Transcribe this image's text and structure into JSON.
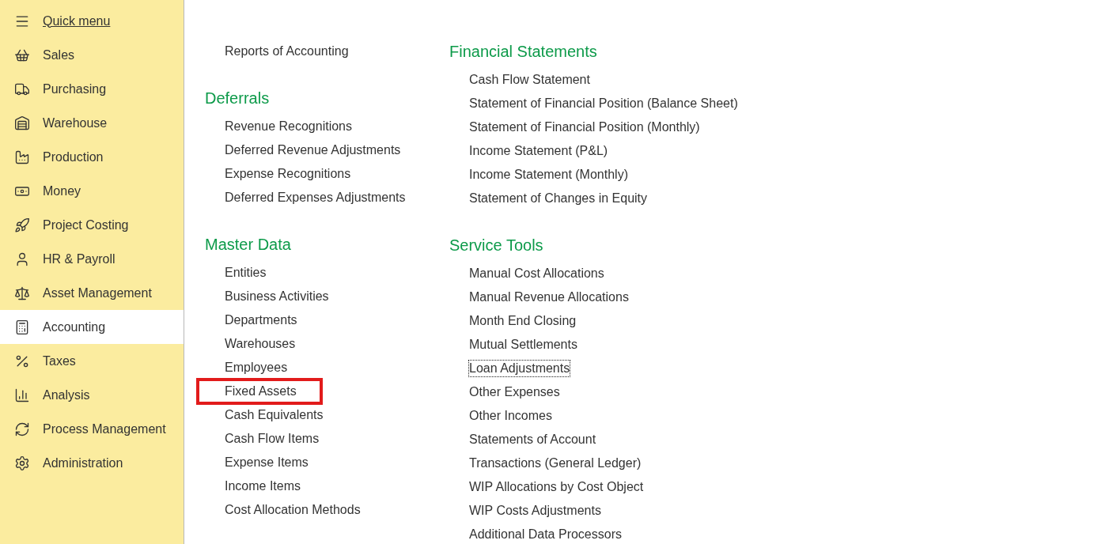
{
  "sidebar": {
    "items": [
      {
        "label": "Quick menu",
        "kind": "quick",
        "selected": false
      },
      {
        "label": "Sales",
        "kind": "section",
        "selected": false
      },
      {
        "label": "Purchasing",
        "kind": "section",
        "selected": false
      },
      {
        "label": "Warehouse",
        "kind": "section",
        "selected": false
      },
      {
        "label": "Production",
        "kind": "section",
        "selected": false
      },
      {
        "label": "Money",
        "kind": "section",
        "selected": false
      },
      {
        "label": "Project Costing",
        "kind": "section",
        "selected": false
      },
      {
        "label": "HR & Payroll",
        "kind": "section",
        "selected": false
      },
      {
        "label": "Asset Management",
        "kind": "section",
        "selected": false
      },
      {
        "label": "Accounting",
        "kind": "section",
        "selected": true
      },
      {
        "label": "Taxes",
        "kind": "section",
        "selected": false
      },
      {
        "label": "Analysis",
        "kind": "section",
        "selected": false
      },
      {
        "label": "Process Management",
        "kind": "section",
        "selected": false
      },
      {
        "label": "Administration",
        "kind": "section",
        "selected": false
      }
    ]
  },
  "columns": [
    {
      "sections": [
        {
          "links": [
            {
              "label": "Reports of Accounting",
              "highlighted": false,
              "focused": false
            }
          ]
        },
        {
          "heading": "Deferrals",
          "links": [
            {
              "label": "Revenue Recognitions",
              "highlighted": false,
              "focused": false
            },
            {
              "label": "Deferred Revenue Adjustments",
              "highlighted": false,
              "focused": false
            },
            {
              "label": "Expense Recognitions",
              "highlighted": false,
              "focused": false
            },
            {
              "label": "Deferred Expenses Adjustments",
              "highlighted": false,
              "focused": false
            }
          ]
        },
        {
          "heading": "Master Data",
          "links": [
            {
              "label": "Entities",
              "highlighted": false,
              "focused": false
            },
            {
              "label": "Business Activities",
              "highlighted": false,
              "focused": false
            },
            {
              "label": "Departments",
              "highlighted": false,
              "focused": false
            },
            {
              "label": "Warehouses",
              "highlighted": false,
              "focused": false
            },
            {
              "label": "Employees",
              "highlighted": false,
              "focused": false
            },
            {
              "label": "Fixed Assets",
              "highlighted": true,
              "focused": false
            },
            {
              "label": "Cash Equivalents",
              "highlighted": false,
              "focused": false
            },
            {
              "label": "Cash Flow Items",
              "highlighted": false,
              "focused": false
            },
            {
              "label": "Expense Items",
              "highlighted": false,
              "focused": false
            },
            {
              "label": "Income Items",
              "highlighted": false,
              "focused": false
            },
            {
              "label": "Cost Allocation Methods",
              "highlighted": false,
              "focused": false
            }
          ]
        }
      ]
    },
    {
      "sections": [
        {
          "heading": "Financial Statements",
          "links": [
            {
              "label": "Cash Flow Statement",
              "highlighted": false,
              "focused": false
            },
            {
              "label": "Statement of Financial Position (Balance Sheet)",
              "highlighted": false,
              "focused": false
            },
            {
              "label": "Statement of Financial Position (Monthly)",
              "highlighted": false,
              "focused": false
            },
            {
              "label": "Income Statement (P&L)",
              "highlighted": false,
              "focused": false
            },
            {
              "label": "Income Statement (Monthly)",
              "highlighted": false,
              "focused": false
            },
            {
              "label": "Statement of Changes in Equity",
              "highlighted": false,
              "focused": false
            }
          ]
        },
        {
          "heading": "Service Tools",
          "links": [
            {
              "label": "Manual Cost Allocations",
              "highlighted": false,
              "focused": false
            },
            {
              "label": "Manual Revenue Allocations",
              "highlighted": false,
              "focused": false
            },
            {
              "label": "Month End Closing",
              "highlighted": false,
              "focused": false
            },
            {
              "label": "Mutual Settlements",
              "highlighted": false,
              "focused": false
            },
            {
              "label": "Loan Adjustments",
              "highlighted": false,
              "focused": true
            },
            {
              "label": "Other Expenses",
              "highlighted": false,
              "focused": false
            },
            {
              "label": "Other Incomes",
              "highlighted": false,
              "focused": false
            },
            {
              "label": "Statements of Account",
              "highlighted": false,
              "focused": false
            },
            {
              "label": "Transactions (General Ledger)",
              "highlighted": false,
              "focused": false
            },
            {
              "label": "WIP Allocations by Cost Object",
              "highlighted": false,
              "focused": false
            },
            {
              "label": "WIP Costs Adjustments",
              "highlighted": false,
              "focused": false
            },
            {
              "label": "Additional Data Processors",
              "highlighted": false,
              "focused": false
            }
          ]
        }
      ]
    }
  ]
}
